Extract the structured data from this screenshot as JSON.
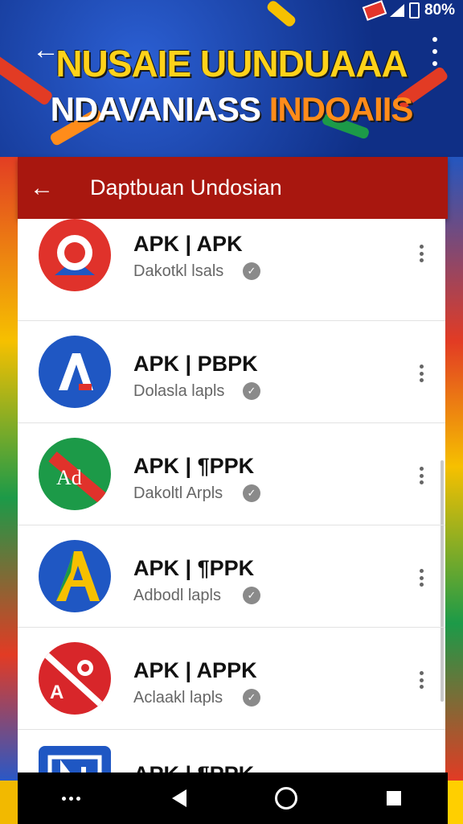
{
  "status_bar": {
    "battery_text": "80%"
  },
  "hero": {
    "title_line1": "NUSAIE UUNDUAAA",
    "title_line2_white": "NDAVANIASS",
    "title_line2_orange": " INDOAIIS"
  },
  "appbar": {
    "title": "Daptbuan Undosian"
  },
  "apps": [
    {
      "name": "APK | APK",
      "subtitle": "Dakotkl lsals",
      "icon": "red-search-icon"
    },
    {
      "name": "APK | PBPK",
      "subtitle": "Dolasla lapls",
      "icon": "blue-a-icon"
    },
    {
      "name": "APK | ¶PPK",
      "subtitle": "Dakoltl Arpls",
      "icon": "green-ad-icon"
    },
    {
      "name": "APK | ¶PPK",
      "subtitle": "Adbodl lapls",
      "icon": "yellow-a-icon"
    },
    {
      "name": "APK | APPK",
      "subtitle": "Aclaakl lapls",
      "icon": "red-no-a-icon"
    },
    {
      "name": "APK | ¶PPK",
      "subtitle": "",
      "icon": "blue-n-icon"
    }
  ],
  "colors": {
    "appbar": "#a8170f",
    "hero_yellow": "#ffd21a",
    "hero_orange": "#ff8c1a"
  }
}
